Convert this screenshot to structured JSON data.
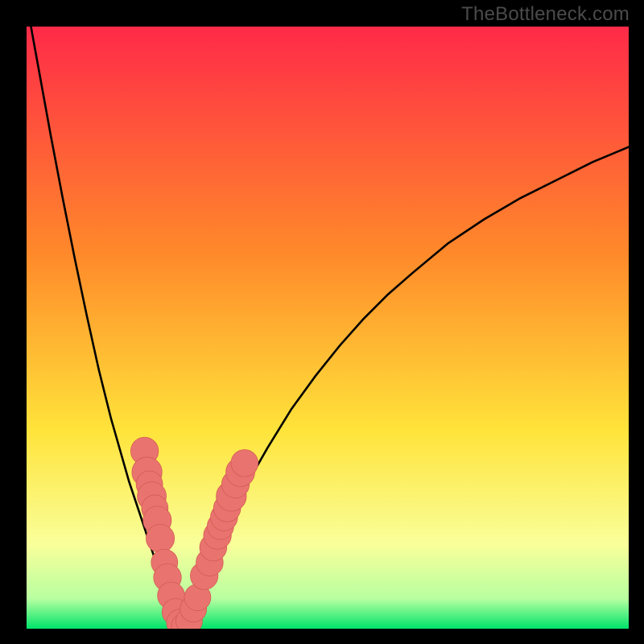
{
  "watermark": "TheBottleneck.com",
  "colors": {
    "frame": "#000000",
    "grad_top": "#ff2a48",
    "grad_mid1": "#ff8a2a",
    "grad_mid2": "#ffe33a",
    "grad_low": "#f9ff9a",
    "grad_base1": "#b8ffa0",
    "grad_base2": "#00e46a",
    "curve": "#000000",
    "marker_fill": "#e9746f",
    "marker_stroke": "#d45a55"
  },
  "chart_data": {
    "type": "line",
    "title": "",
    "xlabel": "",
    "ylabel": "",
    "xlim": [
      0,
      100
    ],
    "ylim": [
      0,
      100
    ],
    "grid": false,
    "legend": false,
    "x": [
      0,
      2,
      4,
      6,
      8,
      10,
      12,
      14,
      16,
      17,
      18,
      19,
      20,
      21,
      22,
      23,
      24,
      25,
      26,
      27,
      28,
      30,
      32,
      34,
      36,
      38,
      40,
      44,
      48,
      52,
      56,
      60,
      64,
      70,
      76,
      82,
      88,
      94,
      100
    ],
    "curve_y": [
      104,
      93,
      82,
      71.5,
      61.5,
      52,
      43,
      35,
      28,
      24.5,
      21.5,
      18.5,
      15.5,
      12.5,
      9.5,
      6.5,
      3.8,
      1.6,
      0.3,
      1.2,
      3.5,
      8.5,
      13.5,
      18,
      22.5,
      26.5,
      30,
      36.5,
      42,
      47,
      51.5,
      55.5,
      59,
      64,
      68,
      71.5,
      74.5,
      77.5,
      80
    ],
    "markers": [
      {
        "x": 19.6,
        "y": 29.5,
        "r": 2.3
      },
      {
        "x": 20.0,
        "y": 26.0,
        "r": 2.5
      },
      {
        "x": 20.4,
        "y": 24.0,
        "r": 2.2
      },
      {
        "x": 20.8,
        "y": 22.0,
        "r": 2.4
      },
      {
        "x": 21.3,
        "y": 20.0,
        "r": 2.2
      },
      {
        "x": 21.7,
        "y": 18.0,
        "r": 2.35
      },
      {
        "x": 22.2,
        "y": 15.0,
        "r": 2.35
      },
      {
        "x": 22.9,
        "y": 11.0,
        "r": 2.2
      },
      {
        "x": 23.4,
        "y": 8.5,
        "r": 2.3
      },
      {
        "x": 24.0,
        "y": 5.5,
        "r": 2.25
      },
      {
        "x": 24.7,
        "y": 2.8,
        "r": 2.2
      },
      {
        "x": 25.5,
        "y": 1.0,
        "r": 2.25
      },
      {
        "x": 26.3,
        "y": 0.4,
        "r": 2.25
      },
      {
        "x": 27.0,
        "y": 1.3,
        "r": 2.2
      },
      {
        "x": 27.7,
        "y": 3.3,
        "r": 2.2
      },
      {
        "x": 28.4,
        "y": 5.2,
        "r": 2.2
      },
      {
        "x": 29.5,
        "y": 8.8,
        "r": 2.3
      },
      {
        "x": 30.4,
        "y": 11.0,
        "r": 2.25
      },
      {
        "x": 31.0,
        "y": 13.5,
        "r": 2.25
      },
      {
        "x": 31.7,
        "y": 15.5,
        "r": 2.3
      },
      {
        "x": 32.2,
        "y": 17.0,
        "r": 2.2
      },
      {
        "x": 32.8,
        "y": 18.5,
        "r": 2.25
      },
      {
        "x": 33.3,
        "y": 20.0,
        "r": 2.25
      },
      {
        "x": 34.0,
        "y": 22.0,
        "r": 2.5
      },
      {
        "x": 34.7,
        "y": 24.0,
        "r": 2.3
      },
      {
        "x": 35.5,
        "y": 26.0,
        "r": 2.4
      },
      {
        "x": 36.2,
        "y": 27.5,
        "r": 2.25
      }
    ]
  }
}
